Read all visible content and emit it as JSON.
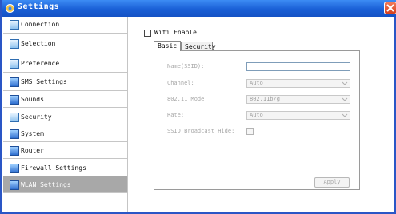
{
  "window": {
    "title": "Settings"
  },
  "sidebar": {
    "items": [
      {
        "label": "Connection",
        "icon": "connection-icon"
      },
      {
        "label": "Selection",
        "icon": "selection-icon"
      },
      {
        "label": "Preference",
        "icon": "preference-icon"
      },
      {
        "label": "SMS Settings",
        "icon": "sms-settings-icon"
      },
      {
        "label": "Sounds",
        "icon": "sounds-icon"
      },
      {
        "label": "Security",
        "icon": "security-icon"
      },
      {
        "label": "System",
        "icon": "system-icon"
      },
      {
        "label": "Router",
        "icon": "router-icon"
      },
      {
        "label": "Firewall Settings",
        "icon": "firewall-settings-icon"
      },
      {
        "label": "WLAN Settings",
        "icon": "wlan-settings-icon",
        "active": true
      }
    ]
  },
  "wifi": {
    "enable_label": "Wifi Enable",
    "enabled": false
  },
  "tabs": {
    "basic": "Basic",
    "security": "Security",
    "active": "Basic"
  },
  "form": {
    "name_label": "Name(SSID):",
    "name_value": "",
    "channel_label": "Channel:",
    "channel_value": "Auto",
    "mode_label": "802.11 Mode:",
    "mode_value": "802.11b/g",
    "rate_label": "Rate:",
    "rate_value": "Auto",
    "broadcast_label": "SSID Broadcast Hide:",
    "broadcast_checked": false
  },
  "apply_label": "Apply",
  "colors": {
    "titlebar": "#1a5fd6",
    "active_item": "#a8a8a8",
    "close": "#d8401c"
  }
}
